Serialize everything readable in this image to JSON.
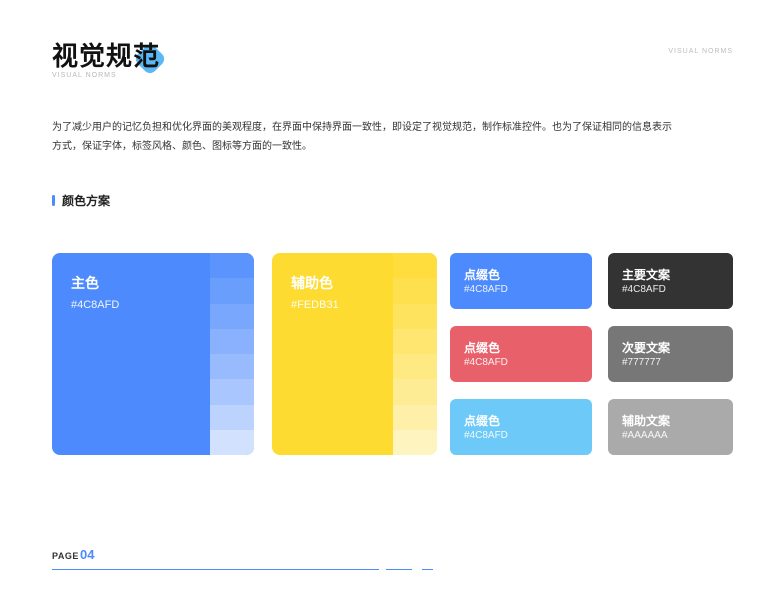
{
  "header": {
    "title": "视觉规范",
    "subtitle": "VISUAL NORMS",
    "corner_label": "VISUAL NORMS"
  },
  "intro": "为了减少用户的记忆负担和优化界面的美观程度，在界面中保持界面一致性，即设定了视觉规范，制作标准控件。也为了保证相同的信息表示方式，保证字体，标签风格、颜色、图标等方面的一致性。",
  "section": {
    "title": "颜色方案"
  },
  "primary": {
    "label": "主色",
    "code": "#4C8AFD",
    "color": "#4C8AFD",
    "tints": [
      "#5B94FD",
      "#6A9EFD",
      "#79A7FD",
      "#89B1FE",
      "#98BBFE",
      "#A9C6FE",
      "#BCD3FE",
      "#D1E1FE"
    ]
  },
  "secondary": {
    "label": "辅助色",
    "code": "#FEDB31",
    "color": "#FEDB31",
    "tints": [
      "#FEDD3D",
      "#FEE04E",
      "#FEE35F",
      "#FEE671",
      "#FEE983",
      "#FEEC95",
      "#FEF0A9",
      "#FEF4C0"
    ]
  },
  "accents": [
    {
      "label": "点缀色",
      "code": "#4C8AFD",
      "color": "#4C8AFD"
    },
    {
      "label": "点缀色",
      "code": "#4C8AFD",
      "color": "#E8606A"
    },
    {
      "label": "点缀色",
      "code": "#4C8AFD",
      "color": "#6DC9F7"
    }
  ],
  "text_colors": [
    {
      "label": "主要文案",
      "code": "#4C8AFD",
      "color": "#333333"
    },
    {
      "label": "次要文案",
      "code": "#777777",
      "color": "#777777"
    },
    {
      "label": "辅助文案",
      "code": "#AAAAAA",
      "color": "#AAAAAA"
    }
  ],
  "footer": {
    "page_label": "PAGE",
    "page_number": "04",
    "accent": "#4C8AFD"
  }
}
